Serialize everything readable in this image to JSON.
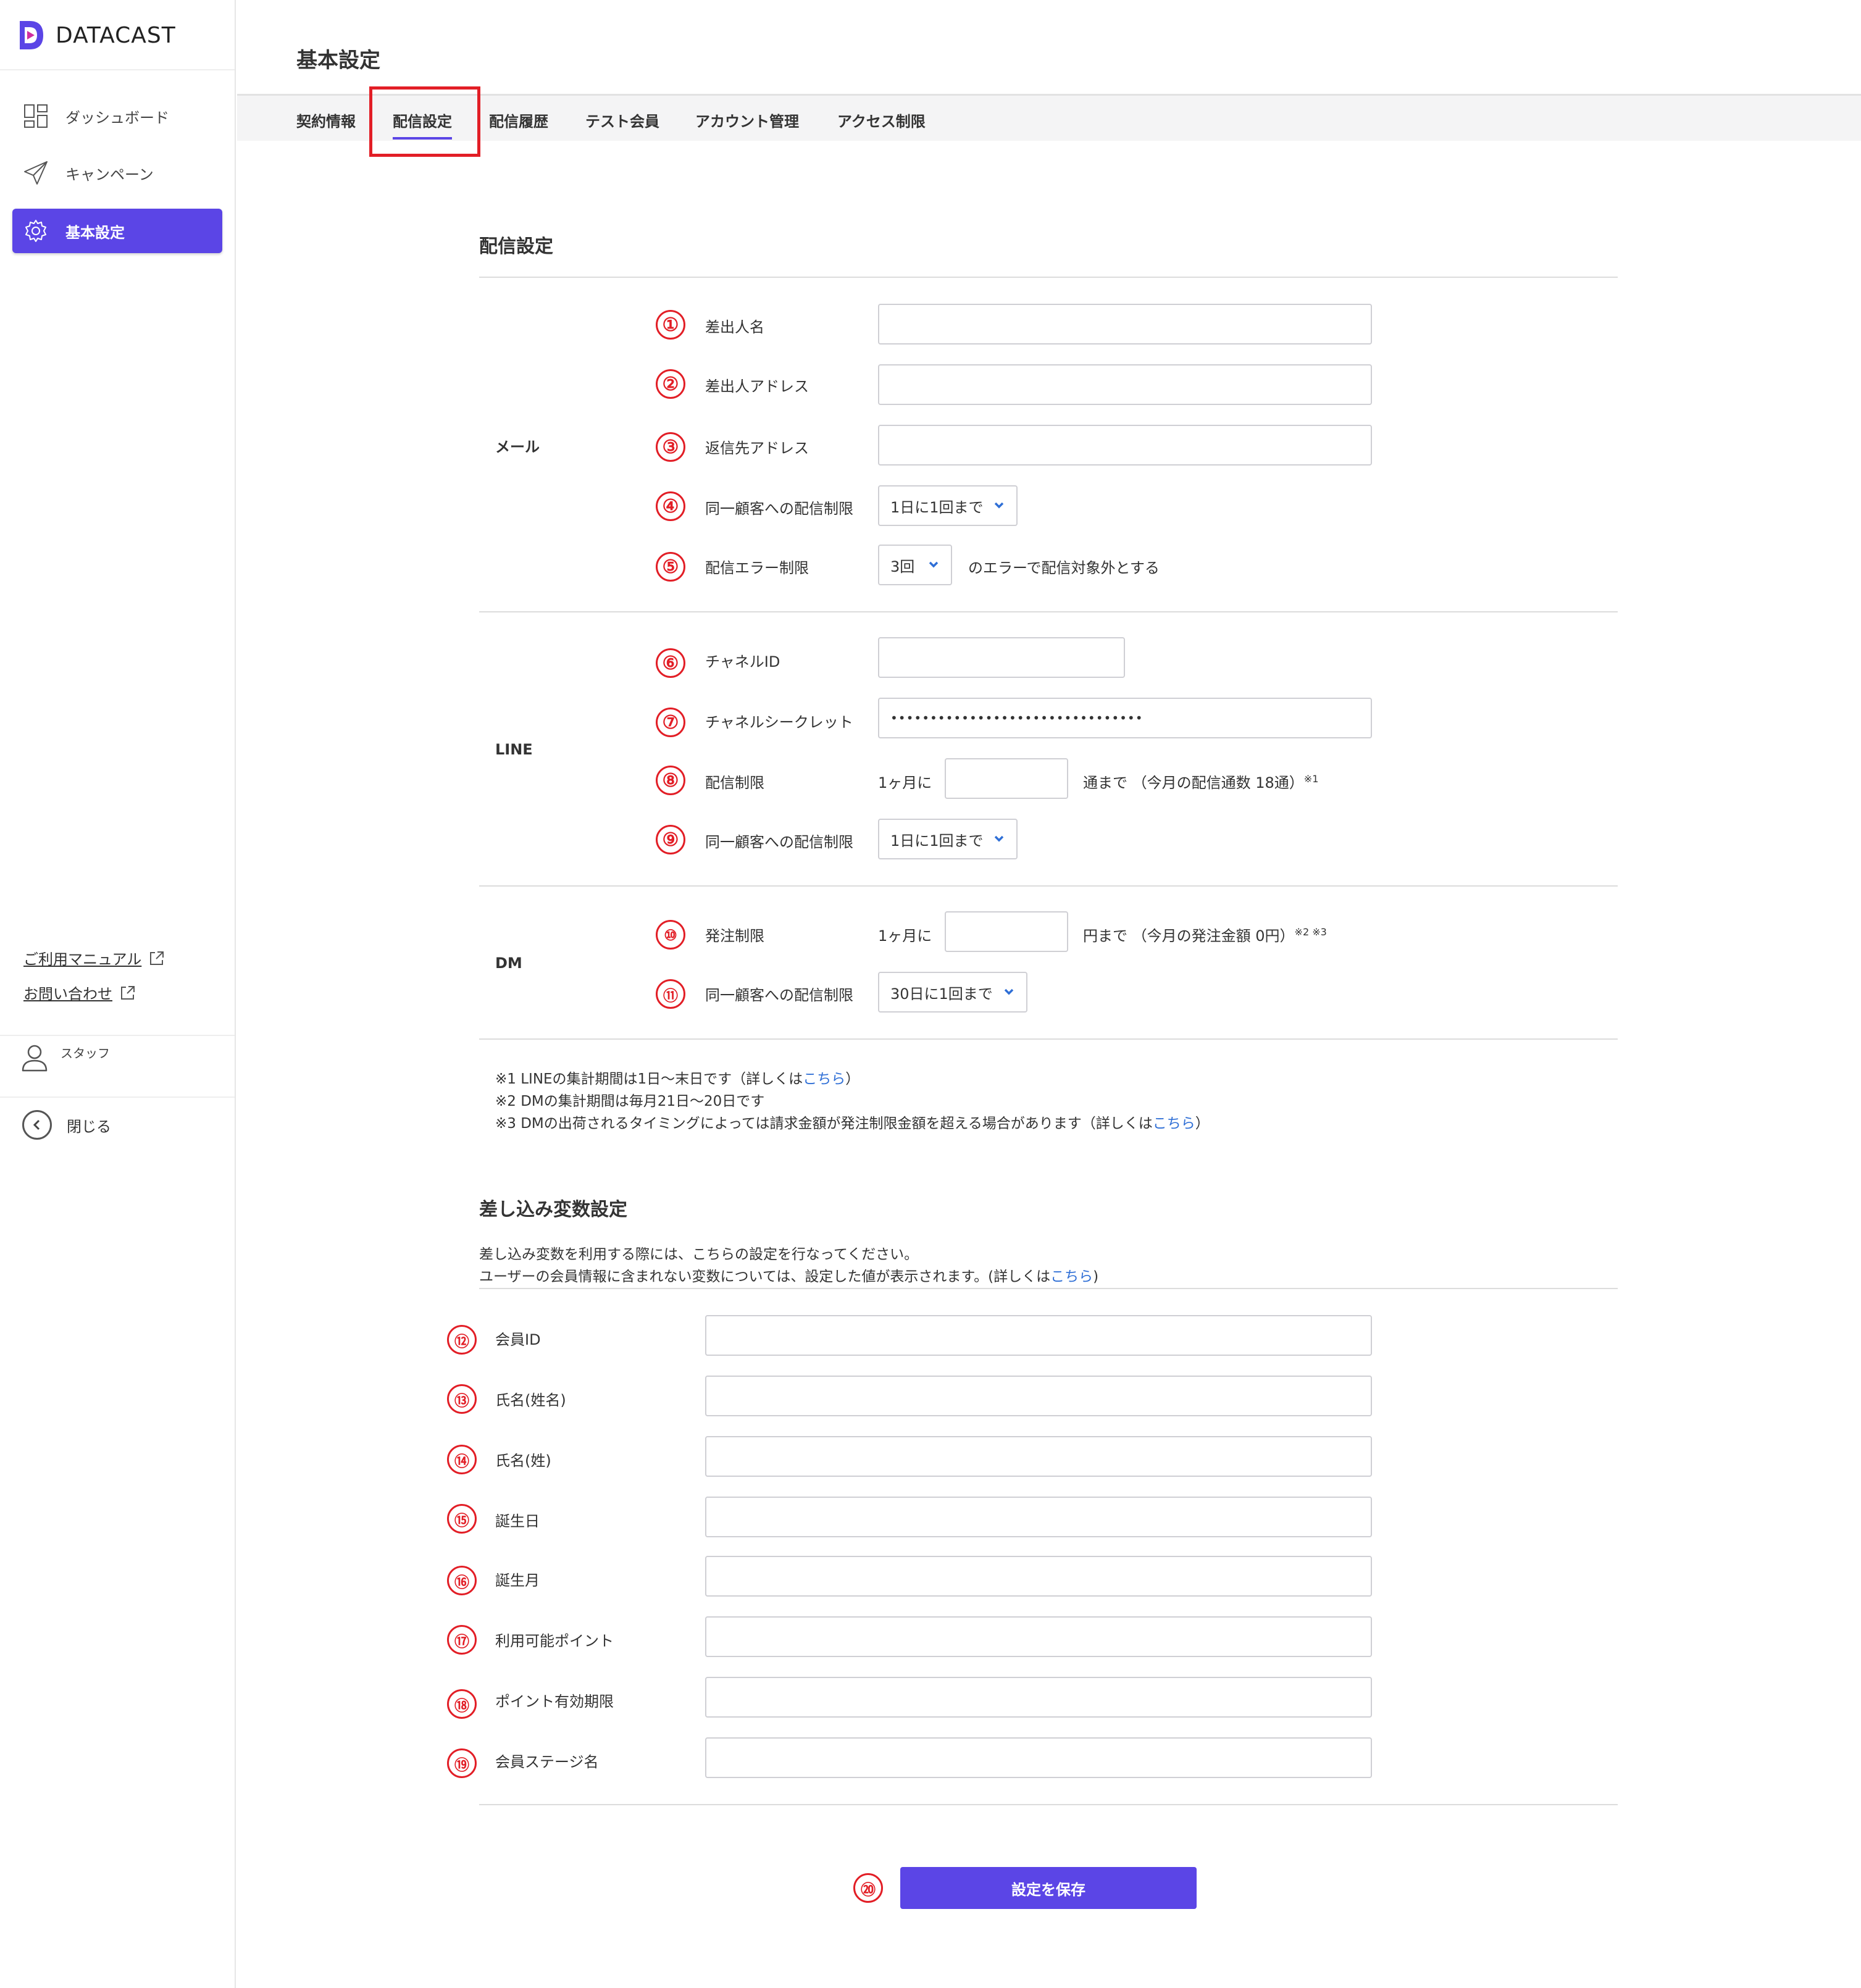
{
  "app": {
    "logo_text": "DATACAST",
    "brand_color": "#5b45e6",
    "annotation_color": "#e21e26"
  },
  "sidebar": {
    "items": [
      {
        "label": "ダッシュボード",
        "icon": "dashboard-grid-icon"
      },
      {
        "label": "キャンペーン",
        "icon": "paper-plane-icon"
      },
      {
        "label": "基本設定",
        "icon": "gear-icon",
        "active": true
      }
    ],
    "links": [
      {
        "label": "ご利用マニュアル",
        "icon": "external-link-icon"
      },
      {
        "label": "お問い合わせ",
        "icon": "external-link-icon"
      }
    ],
    "user_label": "スタッフ",
    "close_label": "閉じる"
  },
  "header": {
    "title": "基本設定",
    "tabs": [
      {
        "label": "契約情報"
      },
      {
        "label": "配信設定",
        "active": true
      },
      {
        "label": "配信履歴"
      },
      {
        "label": "テスト会員"
      },
      {
        "label": "アカウント管理"
      },
      {
        "label": "アクセス制限"
      }
    ]
  },
  "delivery": {
    "section_title": "配信設定",
    "mail": {
      "group_label": "メール",
      "sender_name": {
        "num": "①",
        "label": "差出人名",
        "value": ""
      },
      "sender_address": {
        "num": "②",
        "label": "差出人アドレス",
        "value": ""
      },
      "reply_address": {
        "num": "③",
        "label": "返信先アドレス",
        "value": ""
      },
      "same_customer_limit": {
        "num": "④",
        "label": "同一顧客への配信制限",
        "value": "1日に1回まで"
      },
      "error_limit": {
        "num": "⑤",
        "label": "配信エラー制限",
        "value": "3回",
        "suffix": "のエラーで配信対象外とする"
      }
    },
    "line": {
      "group_label": "LINE",
      "channel_id": {
        "num": "⑥",
        "label": "チャネルID",
        "value": ""
      },
      "channel_secret": {
        "num": "⑦",
        "label": "チャネルシークレット",
        "value": "••••••••••••••••••••••••••••••••"
      },
      "delivery_limit": {
        "num": "⑧",
        "label": "配信制限",
        "prefix": "1ヶ月に",
        "value": "",
        "suffix": "通まで （今月の配信通数 18通）",
        "note_ref": "※1"
      },
      "same_customer_limit": {
        "num": "⑨",
        "label": "同一顧客への配信制限",
        "value": "1日に1回まで"
      }
    },
    "dm": {
      "group_label": "DM",
      "order_limit": {
        "num": "⑩",
        "label": "発注制限",
        "prefix": "1ヶ月に",
        "value": "",
        "suffix": "円まで （今月の発注金額 0円）",
        "note_ref": "※2 ※3"
      },
      "same_customer_limit": {
        "num": "⑪",
        "label": "同一顧客への配信制限",
        "value": "30日に1回まで"
      }
    },
    "notes": [
      {
        "text": "※1 LINEの集計期間は1日〜末日です（詳しくは",
        "link": "こちら",
        "after": "）"
      },
      {
        "text": "※2 DMの集計期間は毎月21日〜20日です",
        "link": "",
        "after": ""
      },
      {
        "text": "※3 DMの出荷されるタイミングによっては請求金額が発注制限金額を超える場合があります（詳しくは",
        "link": "こちら",
        "after": "）"
      }
    ]
  },
  "variables": {
    "section_title": "差し込み変数設定",
    "desc_line1": "差し込み変数を利用する際には、こちらの設定を行なってください。",
    "desc_line2": "ユーザーの会員情報に含まれない変数については、設定した値が表示されます。(詳しくは",
    "desc_link": "こちら",
    "desc_after": ")",
    "fields": [
      {
        "num": "⑫",
        "label": "会員ID",
        "value": ""
      },
      {
        "num": "⑬",
        "label": "氏名(姓名)",
        "value": ""
      },
      {
        "num": "⑭",
        "label": "氏名(姓)",
        "value": ""
      },
      {
        "num": "⑮",
        "label": "誕生日",
        "value": ""
      },
      {
        "num": "⑯",
        "label": "誕生月",
        "value": ""
      },
      {
        "num": "⑰",
        "label": "利用可能ポイント",
        "value": ""
      },
      {
        "num": "⑱",
        "label": "ポイント有効期限",
        "value": ""
      },
      {
        "num": "⑲",
        "label": "会員ステージ名",
        "value": ""
      }
    ]
  },
  "save": {
    "num": "⑳",
    "label": "設定を保存"
  }
}
